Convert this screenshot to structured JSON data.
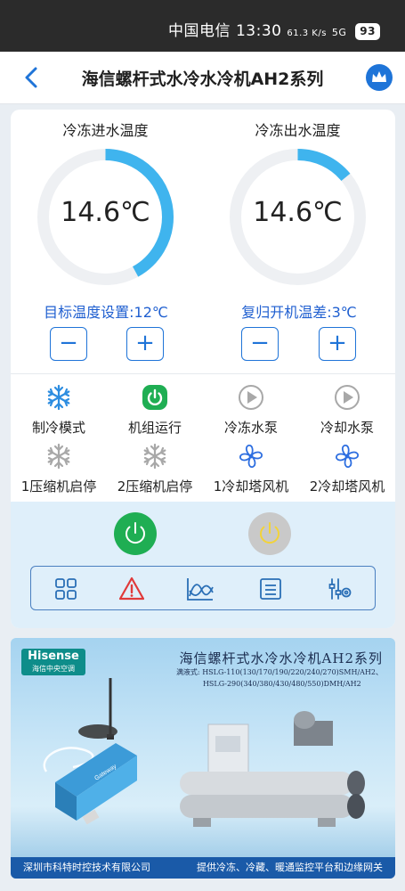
{
  "status_bar": {
    "carrier": "中国电信",
    "time": "13:30",
    "speed": "61.3 K/s",
    "network": "5G",
    "battery": "93"
  },
  "header": {
    "title": "海信螺杆式水冷水冷机AH2系列"
  },
  "gauges": [
    {
      "label": "冷冻进水温度",
      "value": "14.6℃",
      "progress": 0.42
    },
    {
      "label": "冷冻出水温度",
      "value": "14.6℃",
      "progress": 0.14
    }
  ],
  "settings": [
    {
      "label": "目标温度设置:12℃"
    },
    {
      "label": "复归开机温差:3℃"
    }
  ],
  "stepper": {
    "minus": "−",
    "plus": "+"
  },
  "status_items": [
    {
      "label": "制冷模式",
      "icon": "snowflake-icon",
      "state": "active"
    },
    {
      "label": "机组运行",
      "icon": "power-icon",
      "state": "on"
    },
    {
      "label": "冷冻水泵",
      "icon": "play-icon",
      "state": "inactive"
    },
    {
      "label": "冷却水泵",
      "icon": "play-icon",
      "state": "inactive"
    },
    {
      "label": "1压缩机启停",
      "icon": "snowflake-icon",
      "state": "inactive"
    },
    {
      "label": "2压缩机启停",
      "icon": "snowflake-icon",
      "state": "inactive"
    },
    {
      "label": "1冷却塔风机",
      "icon": "fan-icon",
      "state": "active"
    },
    {
      "label": "2冷却塔风机",
      "icon": "fan-icon",
      "state": "active"
    }
  ],
  "toolbar": {
    "items": [
      "grid-icon",
      "alarm-icon",
      "trend-chart-icon",
      "list-icon",
      "sliders-icon"
    ]
  },
  "banner": {
    "brand": "Hisense",
    "brand_sub": "海信中央空调",
    "title": "海信螺杆式水冷水冷机AH2系列",
    "models_prefix": "满液式:",
    "models_line1": "HSLG-110(130/170/190/220/240/270)SMH/AH2、",
    "models_line2": "HSLG-290(340/380/430/480/550)DMH/AH2",
    "device_label": "Gateway",
    "footer_left": "深圳市科特时控技术有限公司",
    "footer_right": "提供冷冻、冷藏、暖通监控平台和边缘网关"
  },
  "colors": {
    "accent": "#1f74d8",
    "gauge_arc": "#3fb4ee",
    "run_green": "#1fae53",
    "snow_blue": "#2d8de0",
    "inactive_gray": "#a8a8a8"
  }
}
